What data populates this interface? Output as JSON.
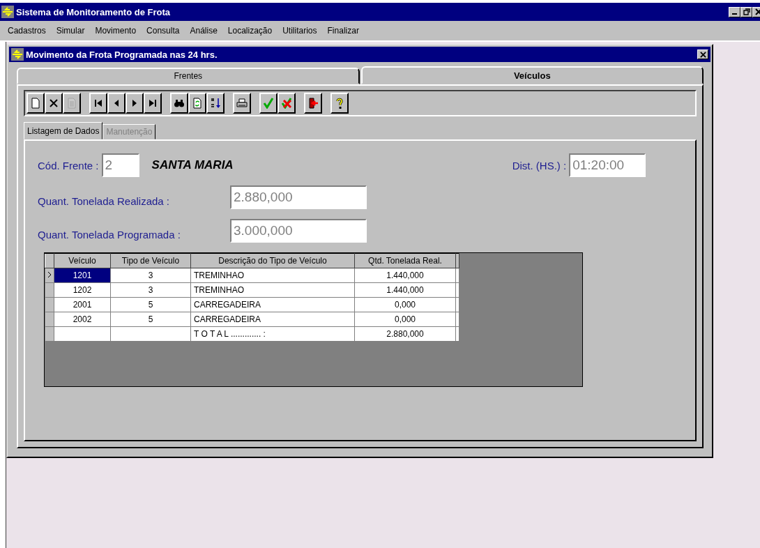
{
  "window": {
    "title": "Sistema de Monitoramento de Frota"
  },
  "menu": [
    "Cadastros",
    "Simular",
    "Movimento",
    "Consulta",
    "Análise",
    "Localização",
    "Utilitarios",
    "Finalizar"
  ],
  "child_window": {
    "title": "Movimento da Frota Programada nas 24 hrs."
  },
  "tabs": [
    {
      "label": "Frentes",
      "selected": false
    },
    {
      "label": "Veículos",
      "selected": true
    }
  ],
  "toolbar": [
    [
      {
        "kind": "new",
        "disabled": false
      },
      {
        "kind": "delete",
        "disabled": false
      },
      {
        "kind": "copy",
        "disabled": true
      }
    ],
    [
      {
        "kind": "first",
        "disabled": false
      },
      {
        "kind": "prev",
        "disabled": false
      },
      {
        "kind": "next",
        "disabled": false
      },
      {
        "kind": "last",
        "disabled": false
      }
    ],
    [
      {
        "kind": "find",
        "disabled": false
      },
      {
        "kind": "refresh",
        "disabled": false
      },
      {
        "kind": "sort",
        "disabled": false
      }
    ],
    [
      {
        "kind": "print",
        "disabled": false
      }
    ],
    [
      {
        "kind": "confirm",
        "disabled": false
      },
      {
        "kind": "cancel",
        "disabled": false
      }
    ],
    [
      {
        "kind": "exit",
        "disabled": false
      }
    ],
    [
      {
        "kind": "help",
        "disabled": false
      }
    ]
  ],
  "subtabs": [
    {
      "label": "Listagem de Dados",
      "selected": true,
      "disabled": false
    },
    {
      "label": "Manutenção",
      "selected": false,
      "disabled": true
    }
  ],
  "form": {
    "cod_frente": {
      "label": "Cód. Frente :",
      "value": "2"
    },
    "frente_name": "SANTA MARIA",
    "dist": {
      "label": "Dist. (HS.) :",
      "value": "01:20:00"
    },
    "realizada": {
      "label": "Quant. Tonelada Realizada :",
      "value": "2.880,000"
    },
    "programada": {
      "label": "Quant. Tonelada Programada :",
      "value": "3.000,000"
    }
  },
  "table": {
    "columns": [
      "Veículo",
      "Tipo de Veículo",
      "Descrição do Tipo de Veículo",
      "Qtd. Tonelada Real."
    ],
    "rows": [
      {
        "cells": [
          "1201",
          "3",
          "TREMINHAO",
          "1.440,000"
        ],
        "selected": true
      },
      {
        "cells": [
          "1202",
          "3",
          "TREMINHAO",
          "1.440,000"
        ],
        "selected": false
      },
      {
        "cells": [
          "2001",
          "5",
          "CARREGADEIRA",
          "0,000"
        ],
        "selected": false
      },
      {
        "cells": [
          "2002",
          "5",
          "CARREGADEIRA",
          "0,000"
        ],
        "selected": false
      },
      {
        "cells": [
          "",
          "",
          "T O T A L ............. :",
          "2.880,000"
        ],
        "selected": false
      }
    ]
  }
}
